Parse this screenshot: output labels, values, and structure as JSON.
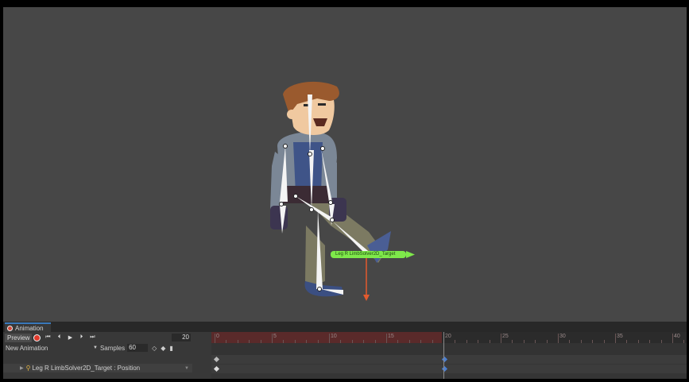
{
  "animation_window": {
    "tab_label": "Animation",
    "preview_label": "Preview",
    "frame_value": "20",
    "clip_name": "New Animation",
    "samples_label": "Samples",
    "samples_value": "60",
    "property_label": "Leg R LimbSolver2D_Target : Position",
    "ruler_labels": [
      "0",
      "5",
      "10",
      "15",
      "20",
      "25",
      "30",
      "35",
      "40"
    ]
  },
  "scene": {
    "target_label": "Leg R LimbSolver2D_Target"
  },
  "colors": {
    "scene_bg": "#474747",
    "record_red": "#e0392b",
    "timeline_recording": "#5a2a2a",
    "key_blue": "#4a7fd4",
    "target_green": "#7ee84a",
    "move_y_axis": "#e35a2e"
  }
}
